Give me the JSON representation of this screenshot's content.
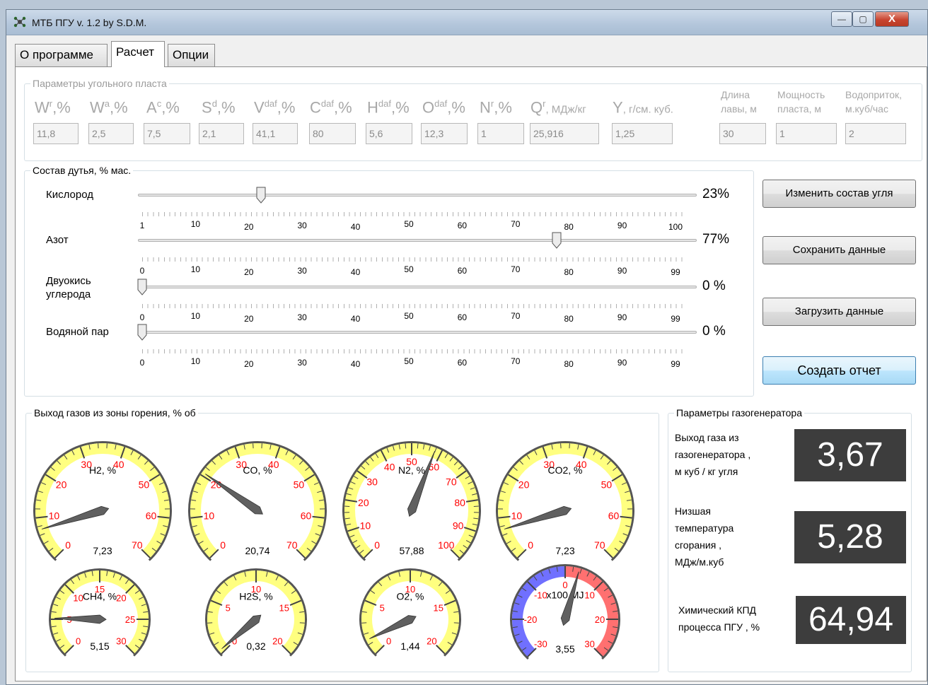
{
  "window": {
    "title": "МТБ ПГУ  v. 1.2 by S.D.M.",
    "min_glyph": "—",
    "max_glyph": "▢",
    "close_glyph": "X"
  },
  "tabs": [
    {
      "label": "О программе"
    },
    {
      "label": "Расчет"
    },
    {
      "label": "Опции"
    }
  ],
  "coal_params": {
    "group_label": "Параметры угольного пласта",
    "fields": [
      {
        "base": "W",
        "sup": "r",
        "unit": ",%",
        "value": "11,8"
      },
      {
        "base": "W",
        "sup": "a",
        "unit": ",%",
        "value": "2,5"
      },
      {
        "base": "A",
        "sup": "c",
        "unit": ",%",
        "value": "7,5"
      },
      {
        "base": "S",
        "sup": "d",
        "unit": ",%",
        "value": "2,1"
      },
      {
        "base": "V",
        "sup": "daf",
        "unit": ",%",
        "value": "41,1"
      },
      {
        "base": "C",
        "sup": "daf",
        "unit": ",%",
        "value": "80"
      },
      {
        "base": "H",
        "sup": "daf",
        "unit": ",%",
        "value": "5,6"
      },
      {
        "base": "O",
        "sup": "daf",
        "unit": ",%",
        "value": "12,3"
      },
      {
        "base": "N",
        "sup": "r",
        "unit": ",%",
        "value": "1"
      },
      {
        "base": "Q",
        "sup": "r",
        "unit": ", МДж/кг",
        "value": "25,916"
      },
      {
        "base": "Y",
        "sup": "",
        "unit": ", г/см. куб.",
        "value": "1,25"
      }
    ],
    "side_fields": [
      {
        "label1": "Длина",
        "label2": "лавы, м",
        "value": "30"
      },
      {
        "label1": "Мощность",
        "label2": "пласта, м",
        "value": "1"
      },
      {
        "label1": "Водоприток,",
        "label2": "м.куб/час",
        "value": "2"
      }
    ]
  },
  "blast": {
    "group_label": "Состав дутья, % мас.",
    "sliders": [
      {
        "label": "Кислород",
        "value": 23,
        "display": "23%",
        "ticks": [
          "1",
          "10",
          "20",
          "30",
          "40",
          "50",
          "60",
          "70",
          "80",
          "90",
          "100"
        ]
      },
      {
        "label": "Азот",
        "value": 77,
        "display": "77%",
        "ticks": [
          "0",
          "10",
          "20",
          "30",
          "40",
          "50",
          "60",
          "70",
          "80",
          "90",
          "99"
        ]
      },
      {
        "label": "Двуокись\nуглерода",
        "value": 0,
        "display": "0 %",
        "ticks": [
          "0",
          "10",
          "20",
          "30",
          "40",
          "50",
          "60",
          "70",
          "80",
          "90",
          "99"
        ]
      },
      {
        "label": "Водяной пар",
        "value": 0,
        "display": "0 %",
        "ticks": [
          "0",
          "10",
          "20",
          "30",
          "40",
          "50",
          "60",
          "70",
          "80",
          "90",
          "99"
        ]
      }
    ]
  },
  "buttons": {
    "change_coal": "Изменить состав угля",
    "save": "Сохранить данные",
    "load": "Загрузить данные",
    "report": "Создать отчет"
  },
  "gas_output": {
    "group_label": "Выход газов из зоны горения, % об",
    "gauges": [
      {
        "name": "H2, %",
        "min": 0,
        "max": 70,
        "labels": [
          "0",
          "10",
          "20",
          "30",
          "40",
          "50",
          "60",
          "70"
        ],
        "value": 7.23,
        "value_text": "7,23",
        "style": "yellow"
      },
      {
        "name": "CO, %",
        "min": 0,
        "max": 70,
        "labels": [
          "0",
          "10",
          "20",
          "30",
          "40",
          "50",
          "60",
          "70"
        ],
        "value": 20.74,
        "value_text": "20,74",
        "style": "yellow"
      },
      {
        "name": "N2, %",
        "min": 0,
        "max": 100,
        "labels": [
          "0",
          "10",
          "20",
          "30",
          "40",
          "50",
          "60",
          "70",
          "80",
          "90",
          "100"
        ],
        "value": 57.88,
        "value_text": "57,88",
        "style": "yellow"
      },
      {
        "name": "CO2, %",
        "min": 0,
        "max": 70,
        "labels": [
          "0",
          "10",
          "20",
          "30",
          "40",
          "50",
          "60",
          "70"
        ],
        "value": 7.23,
        "value_text": "7,23",
        "style": "yellow"
      },
      {
        "name": "CH4, %",
        "min": 0,
        "max": 30,
        "labels": [
          "0",
          "5",
          "10",
          "15",
          "20",
          "25",
          "30"
        ],
        "value": 5.15,
        "value_text": "5,15",
        "style": "yellow"
      },
      {
        "name": "H2S, %",
        "min": 0,
        "max": 20,
        "labels": [
          "0",
          "5",
          "10",
          "15",
          "20"
        ],
        "value": 0.32,
        "value_text": "0,32",
        "style": "yellow"
      },
      {
        "name": "O2, %",
        "min": 0,
        "max": 20,
        "labels": [
          "0",
          "5",
          "10",
          "15",
          "20"
        ],
        "value": 1.44,
        "value_text": "1,44",
        "style": "yellow"
      },
      {
        "name": "x100 MJ",
        "min": -30,
        "max": 30,
        "labels": [
          "-30",
          "-20",
          "-10",
          "0",
          "10",
          "20",
          "30"
        ],
        "value": 3.55,
        "value_text": "3,55",
        "style": "bicolor"
      }
    ]
  },
  "generator": {
    "group_label": "Параметры газогенератора",
    "items": [
      {
        "lines": [
          "Выход газа из",
          "газогенератора ,",
          "м куб / кг угля"
        ],
        "value": "3,67"
      },
      {
        "lines": [
          "Низшая",
          "температура",
          "сгорания ,",
          "МДж/м.куб"
        ],
        "value": "5,28"
      },
      {
        "lines": [
          "Химический КПД",
          "процесса ПГУ , %"
        ],
        "value": "64,94"
      }
    ]
  },
  "colors": {
    "gauge_yellow": "#ffff80",
    "gauge_label_red": "#ff0000",
    "gauge_blue": "#7070ff",
    "gauge_red": "#ff7070",
    "lcd_bg": "#3d3d3d",
    "needle": "#606060"
  }
}
